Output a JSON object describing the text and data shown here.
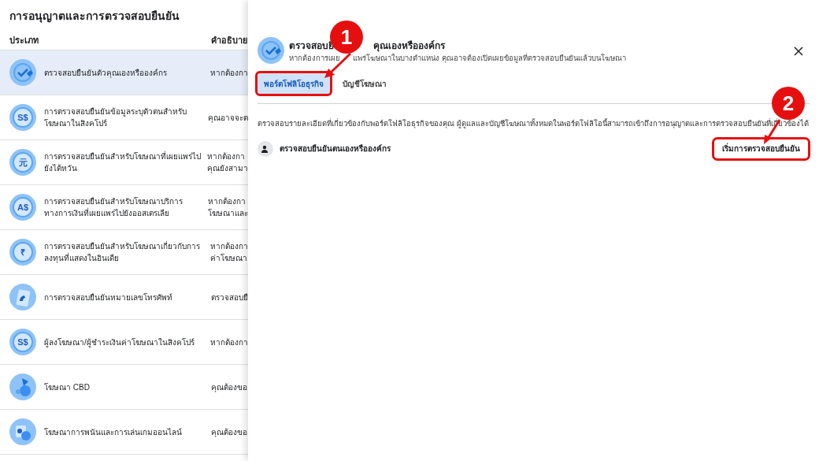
{
  "page_title": "การอนุญาตและการตรวจสอบยืนยัน",
  "table": {
    "columns": [
      "ประเภท",
      "คำอธิบาย"
    ],
    "rows": [
      {
        "kind": "check",
        "name": "ตรวจสอบยืนยันตัวคุณเองหรือองค์กร",
        "description": [
          "หากต้องกา"
        ],
        "selected": true
      },
      {
        "kind": "currency",
        "glyph": "S$",
        "name": "การตรวจสอบยืนยันข้อมูลระบุตัวตนสำหรับโฆษณาในสิงคโปร์",
        "description": [
          "คุณอาจจะต"
        ],
        "selected": false
      },
      {
        "kind": "currency",
        "glyph": "元",
        "name": "การตรวจสอบยืนยันสำหรับโฆษณาที่เผยแพร่ไปยังไต้หวัน",
        "description": [
          "หากต้องกา",
          "คุณยังสามา"
        ],
        "selected": false
      },
      {
        "kind": "currency",
        "glyph": "A$",
        "name": "การตรวจสอบยืนยันสำหรับโฆษณาบริการทางการเงินที่เผยแพร่ไปยังออสเตรเลีย",
        "description": [
          "หากต้องกา",
          "โฆษณาและ"
        ],
        "selected": false
      },
      {
        "kind": "currency",
        "glyph": "₹",
        "name": "การตรวจสอบยืนยันสำหรับโฆษณาเกี่ยวกับการลงทุนที่แสดงในอินเดีย",
        "description": [
          "หากต้องกา",
          "ค่าโฆษณา"
        ],
        "selected": false
      },
      {
        "kind": "phone",
        "name": "การตรวจสอบยืนยันหมายเลขโทรศัพท์",
        "description": [
          "ตรวจสอบยื"
        ],
        "selected": false
      },
      {
        "kind": "currency",
        "glyph": "S$",
        "name": "ผู้ลงโฆษณา/ผู้ชำระเงินค่าโฆษณาในสิงคโปร์",
        "description": [
          "หากต้องกา"
        ],
        "selected": false
      },
      {
        "kind": "cbd",
        "name": "โฆษณา CBD",
        "description": [
          "คุณต้องขอ"
        ],
        "selected": false
      },
      {
        "kind": "cards",
        "name": "โฆษณาการพนันและการเล่นเกมออนไลน์",
        "description": [
          "คุณต้องขอ"
        ],
        "selected": false
      }
    ]
  },
  "panel": {
    "title_parts": [
      "ตรวจสอบยื",
      "คุณเองหรือองค์กร"
    ],
    "subtitle_parts": [
      "หากต้องการเผย",
      "แพร่โฆษณาในบางตำแหน่ง คุณอาจต้องเปิดเผยข้อมูลที่ตรวจสอบยืนยันแล้วบนโฆษณา"
    ],
    "tabs": [
      {
        "label": "พอร์ตโฟลิโอธุรกิจ",
        "selected": true
      },
      {
        "label": "บัญชีโฆษณา",
        "selected": false
      }
    ],
    "description": "ตรวจสอบรายละเอียดที่เกี่ยวข้องกับพอร์ตโฟลิโอธุรกิจของคุณ ผู้ดูแลและบัญชีโฆษณาทั้งหมดในพอร์ตโฟลิโอนี้สามารถเข้าถึงการอนุญาตและการตรวจสอบยืนยันที่เกี่ยวข้องได้",
    "item": {
      "label": "ตรวจสอบยืนยันตนเองหรือองค์กร",
      "button": "เริ่มการตรวจสอบยืนยัน"
    }
  },
  "annotations": [
    {
      "number": "1"
    },
    {
      "number": "2"
    }
  ]
}
